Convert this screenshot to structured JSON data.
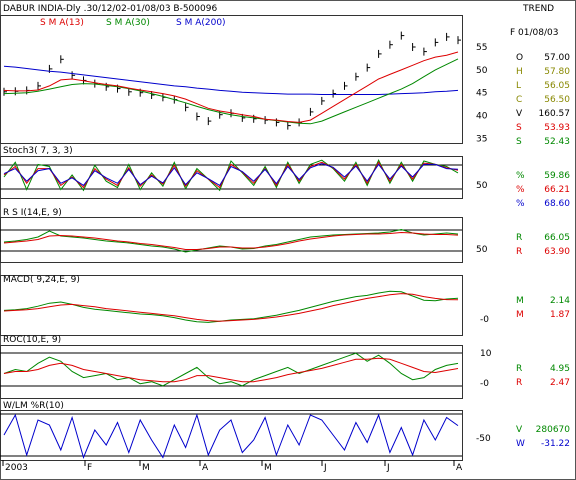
{
  "header": {
    "title": "DABUR INDIA-Dly .30/12/02-01/08/03  B-500096",
    "trend_label": "TREND",
    "date_label": "F 01/08/03"
  },
  "legend": [
    {
      "label": "S M A(13)",
      "color": "#dd0000"
    },
    {
      "label": "S M A(30)",
      "color": "#008800"
    },
    {
      "label": "S M A(200)",
      "color": "#0000cc"
    }
  ],
  "colors": {
    "black": "#000000",
    "red": "#dd0000",
    "green": "#008800",
    "blue": "#0000cc",
    "olive": "#888800",
    "axis": "#333333"
  },
  "panels": {
    "price": {
      "ticks": [
        "55",
        "50",
        "45",
        "40",
        "35"
      ],
      "stats": [
        {
          "k": "O",
          "v": "57.00",
          "color": "#000000"
        },
        {
          "k": "H",
          "v": "57.80",
          "color": "#888800"
        },
        {
          "k": "L",
          "v": "56.05",
          "color": "#888800"
        },
        {
          "k": "C",
          "v": "56.50",
          "color": "#888800"
        },
        {
          "k": "V",
          "v": "160.57",
          "color": "#000000"
        },
        {
          "k": "S",
          "v": "53.93",
          "color": "#dd0000"
        },
        {
          "k": "S",
          "v": "52.43",
          "color": "#008800"
        }
      ]
    },
    "stoch": {
      "title": "Stoch3( 7, 3, 3)",
      "tick": "50",
      "stats": [
        {
          "k": "%",
          "v": "59.86",
          "color": "#008800"
        },
        {
          "k": "%",
          "v": "66.21",
          "color": "#dd0000"
        },
        {
          "k": "%",
          "v": "68.60",
          "color": "#0000cc"
        }
      ]
    },
    "rsi": {
      "title": "R S I(14,E, 9)",
      "tick": "50",
      "stats": [
        {
          "k": "R",
          "v": "66.05",
          "color": "#008800"
        },
        {
          "k": "R",
          "v": "63.90",
          "color": "#dd0000"
        }
      ]
    },
    "macd": {
      "title": "MACD( 9,24,E, 9)",
      "tick": "-0",
      "stats": [
        {
          "k": "M",
          "v": "2.14",
          "color": "#008800"
        },
        {
          "k": "M",
          "v": "1.87",
          "color": "#dd0000"
        }
      ]
    },
    "roc": {
      "title": "ROC(10,E, 9)",
      "ticks": [
        "10",
        "-0"
      ],
      "stats": [
        {
          "k": "R",
          "v": "4.95",
          "color": "#008800"
        },
        {
          "k": "R",
          "v": "2.47",
          "color": "#dd0000"
        }
      ]
    },
    "wlm": {
      "title": "W/LM %R(10)",
      "tick": "-50",
      "stats": [
        {
          "k": "V",
          "v": "280670",
          "color": "#008800"
        },
        {
          "k": "W",
          "v": "-31.22",
          "color": "#0000cc"
        }
      ]
    }
  },
  "x_axis": {
    "labels": [
      "2003",
      "F",
      "M",
      "A",
      "M",
      "J",
      "J",
      "A"
    ]
  },
  "chart_data": {
    "type": "line",
    "title": "DABUR INDIA-Dly .30/12/02-01/08/03  B-500096",
    "x_range": [
      "30/12/02",
      "01/08/03"
    ],
    "price_ylim": [
      34,
      62
    ],
    "series": [
      {
        "name": "S M A(13)",
        "values": [
          45.5,
          45.4,
          45.4,
          45.6,
          46.5,
          47.8,
          48.0,
          47.6,
          47.2,
          46.8,
          46.5,
          46.0,
          45.6,
          45.2,
          44.8,
          44.3,
          43.6,
          42.6,
          41.6,
          41.0,
          40.6,
          40.2,
          39.8,
          39.2,
          39.0,
          38.7,
          38.5,
          39.0,
          40.5,
          42.0,
          43.5,
          45.0,
          46.5,
          48.0,
          49.0,
          50.0,
          51.0,
          52.0,
          52.8,
          53.2,
          53.9
        ]
      },
      {
        "name": "S M A(30)",
        "values": [
          44.8,
          44.9,
          45.0,
          45.3,
          45.8,
          46.3,
          46.8,
          47.0,
          46.9,
          46.6,
          46.3,
          45.9,
          45.4,
          44.8,
          44.2,
          43.5,
          42.8,
          42.0,
          41.3,
          40.7,
          40.2,
          39.8,
          39.5,
          39.2,
          38.9,
          38.6,
          38.3,
          38.2,
          38.8,
          39.8,
          40.8,
          41.8,
          42.8,
          43.8,
          44.8,
          45.8,
          47.0,
          48.5,
          50.0,
          51.2,
          52.4
        ]
      },
      {
        "name": "S M A(200)",
        "values": [
          50.8,
          50.6,
          50.3,
          50.0,
          49.7,
          49.5,
          49.2,
          48.9,
          48.6,
          48.3,
          48.0,
          47.7,
          47.4,
          47.1,
          46.8,
          46.5,
          46.3,
          46.0,
          45.8,
          45.5,
          45.3,
          45.1,
          45.0,
          44.9,
          44.8,
          44.7,
          44.7,
          44.7,
          44.6,
          44.6,
          44.6,
          44.6,
          44.6,
          44.6,
          44.7,
          44.8,
          44.9,
          45.0,
          45.2,
          45.3,
          45.5
        ]
      },
      {
        "name": "Price",
        "values": [
          45.2,
          45.3,
          45.5,
          46.5,
          50.2,
          52.3,
          48.8,
          47.7,
          47.0,
          46.3,
          45.9,
          45.2,
          45.0,
          44.5,
          44.0,
          43.5,
          41.8,
          39.8,
          38.8,
          40.2,
          40.5,
          39.5,
          39.3,
          39.0,
          38.5,
          37.8,
          38.5,
          40.8,
          43.2,
          44.8,
          46.5,
          48.5,
          50.5,
          53.5,
          55.5,
          57.5,
          55.0,
          54.0,
          56.0,
          57.2,
          56.5
        ]
      },
      {
        "name": "Stoch %K",
        "values": [
          50,
          85,
          20,
          80,
          75,
          20,
          55,
          18,
          78,
          40,
          25,
          80,
          20,
          60,
          28,
          85,
          22,
          70,
          45,
          18,
          88,
          60,
          30,
          75,
          25,
          85,
          35,
          80,
          90,
          70,
          40,
          85,
          30,
          90,
          35,
          85,
          40,
          88,
          80,
          75,
          59.86
        ]
      },
      {
        "name": "Stoch %D",
        "values": [
          55,
          75,
          35,
          70,
          70,
          30,
          50,
          25,
          70,
          45,
          30,
          72,
          28,
          55,
          33,
          78,
          28,
          65,
          45,
          25,
          80,
          62,
          35,
          70,
          30,
          80,
          40,
          75,
          85,
          72,
          45,
          80,
          35,
          85,
          40,
          80,
          45,
          83,
          80,
          72,
          66.21
        ]
      },
      {
        "name": "Stoch %D slow",
        "values": [
          58,
          70,
          40,
          65,
          70,
          35,
          48,
          30,
          65,
          48,
          35,
          68,
          32,
          52,
          36,
          72,
          32,
          60,
          46,
          30,
          75,
          63,
          40,
          68,
          34,
          75,
          44,
          72,
          82,
          73,
          50,
          76,
          40,
          80,
          45,
          76,
          50,
          80,
          80,
          70,
          68.6
        ]
      },
      {
        "name": "R S I",
        "values": [
          50,
          52,
          55,
          60,
          72,
          62,
          60,
          58,
          55,
          52,
          50,
          48,
          45,
          42,
          40,
          36,
          30,
          34,
          38,
          42,
          40,
          36,
          37,
          42,
          45,
          50,
          55,
          60,
          62,
          64,
          65,
          66,
          67,
          68,
          70,
          75,
          68,
          64,
          66,
          68,
          66.05
        ]
      },
      {
        "name": "R S I signal",
        "values": [
          48,
          50,
          52,
          55,
          62,
          63,
          62,
          60,
          58,
          55,
          52,
          50,
          47,
          45,
          42,
          39,
          35,
          35,
          37,
          40,
          40,
          38,
          38,
          40,
          43,
          47,
          52,
          56,
          59,
          62,
          64,
          65,
          66,
          66,
          67,
          69,
          68,
          66,
          65,
          65,
          63.9
        ]
      },
      {
        "name": "MACD",
        "values": [
          0.1,
          0.2,
          0.4,
          0.8,
          1.3,
          1.5,
          1.1,
          0.6,
          0.3,
          0.1,
          -0.1,
          -0.3,
          -0.5,
          -0.6,
          -0.8,
          -1.1,
          -1.5,
          -1.8,
          -1.9,
          -1.7,
          -1.5,
          -1.4,
          -1.3,
          -1.0,
          -0.7,
          -0.3,
          0.1,
          0.6,
          1.1,
          1.6,
          2.0,
          2.4,
          2.6,
          3.0,
          3.3,
          3.2,
          2.5,
          1.8,
          1.7,
          2.0,
          2.14
        ]
      },
      {
        "name": "MACD signal",
        "values": [
          0.0,
          0.1,
          0.2,
          0.4,
          0.7,
          1.0,
          1.1,
          0.9,
          0.7,
          0.4,
          0.2,
          0.0,
          -0.2,
          -0.4,
          -0.6,
          -0.8,
          -1.1,
          -1.4,
          -1.6,
          -1.7,
          -1.6,
          -1.5,
          -1.4,
          -1.2,
          -1.0,
          -0.7,
          -0.4,
          0.0,
          0.4,
          0.9,
          1.3,
          1.7,
          2.1,
          2.4,
          2.7,
          2.9,
          2.8,
          2.4,
          2.1,
          1.9,
          1.87
        ]
      },
      {
        "name": "ROC",
        "values": [
          0,
          2,
          1,
          5,
          8,
          6,
          1,
          -2,
          -1,
          0,
          -3,
          -2,
          -5,
          -4,
          -6,
          -3,
          0,
          3,
          -2,
          -5,
          -4,
          -6,
          -3,
          -1,
          1,
          3,
          0,
          2,
          4,
          6,
          8,
          10,
          6,
          9,
          5,
          0,
          -3,
          -2,
          2,
          4,
          4.95
        ]
      },
      {
        "name": "ROC signal",
        "values": [
          0,
          1,
          1,
          2,
          4,
          5,
          4,
          2,
          1,
          0,
          -1,
          -2,
          -3,
          -3.5,
          -4,
          -4,
          -3,
          -1,
          -1,
          -2,
          -3,
          -4,
          -4,
          -3,
          -2,
          -0.5,
          0.5,
          1.5,
          2.5,
          4,
          5.5,
          7,
          7,
          7.5,
          7,
          5,
          3,
          1,
          0.5,
          1.5,
          2.47
        ]
      },
      {
        "name": "W/LM %R",
        "values": [
          -50,
          -10,
          -90,
          -20,
          -30,
          -80,
          -15,
          -95,
          -40,
          -70,
          -25,
          -85,
          -20,
          -60,
          -95,
          -30,
          -75,
          -10,
          -90,
          -40,
          -20,
          -85,
          -60,
          -15,
          -90,
          -30,
          -70,
          -10,
          -20,
          -50,
          -80,
          -25,
          -65,
          -10,
          -85,
          -35,
          -90,
          -20,
          -60,
          -15,
          -31.22
        ]
      }
    ]
  }
}
